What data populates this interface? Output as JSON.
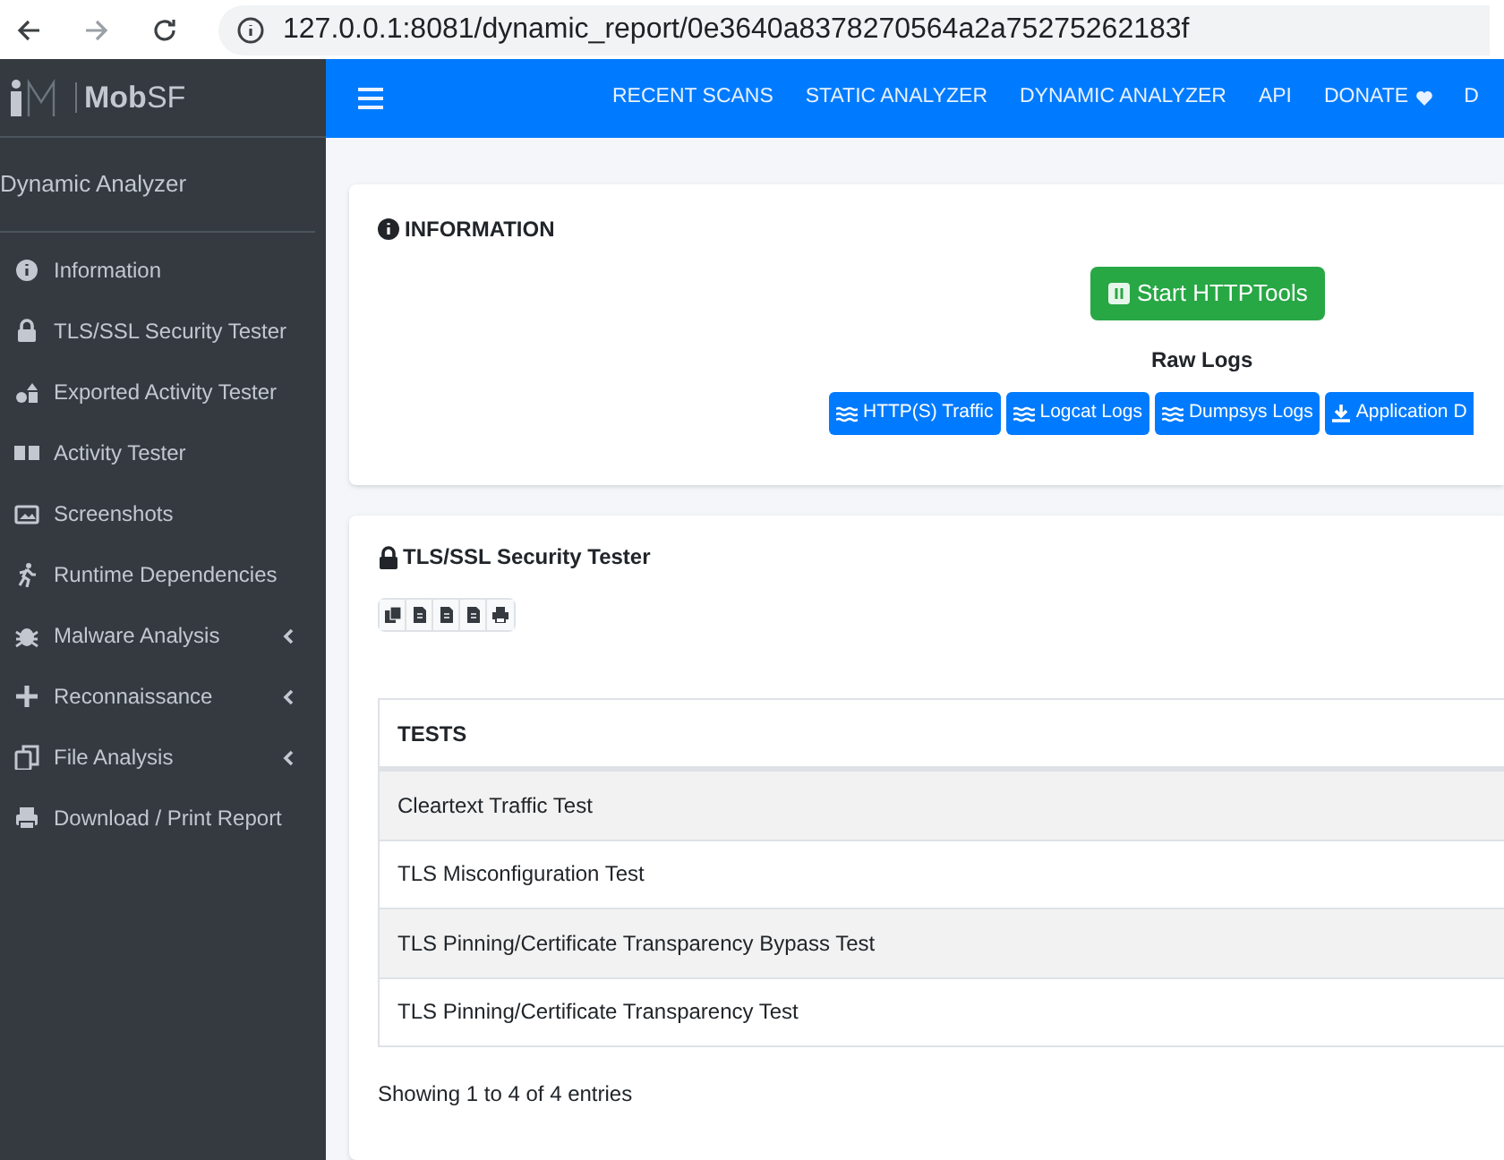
{
  "browser": {
    "url": "127.0.0.1:8081/dynamic_report/0e3640a8378270564a2a75275262183f"
  },
  "brand": {
    "name_bold": "Mob",
    "name_light": "SF"
  },
  "nav": [
    "RECENT SCANS",
    "STATIC ANALYZER",
    "DYNAMIC ANALYZER",
    "API",
    "DONATE",
    "D"
  ],
  "sidebar": {
    "header": "Dynamic Analyzer",
    "items": [
      {
        "label": "Information",
        "expandable": false
      },
      {
        "label": "TLS/SSL Security Tester",
        "expandable": false
      },
      {
        "label": "Exported Activity Tester",
        "expandable": false
      },
      {
        "label": "Activity Tester",
        "expandable": false
      },
      {
        "label": "Screenshots",
        "expandable": false
      },
      {
        "label": "Runtime Dependencies",
        "expandable": false
      },
      {
        "label": "Malware Analysis",
        "expandable": true
      },
      {
        "label": "Reconnaissance",
        "expandable": true
      },
      {
        "label": "File Analysis",
        "expandable": true
      },
      {
        "label": "Download / Print Report",
        "expandable": false
      }
    ]
  },
  "information": {
    "title": "INFORMATION",
    "start_button": "Start HTTPTools",
    "raw_logs_title": "Raw Logs",
    "log_buttons": [
      "HTTP(S) Traffic",
      "Logcat Logs",
      "Dumpsys Logs",
      "Application D"
    ]
  },
  "tls": {
    "title": "TLS/SSL Security Tester",
    "table": {
      "columns": [
        "TESTS"
      ],
      "rows": [
        [
          "Cleartext Traffic Test"
        ],
        [
          "TLS Misconfiguration Test"
        ],
        [
          "TLS Pinning/Certificate Transparency Bypass Test"
        ],
        [
          "TLS Pinning/Certificate Transparency Test"
        ]
      ]
    },
    "footer": "Showing 1 to 4 of 4 entries"
  }
}
